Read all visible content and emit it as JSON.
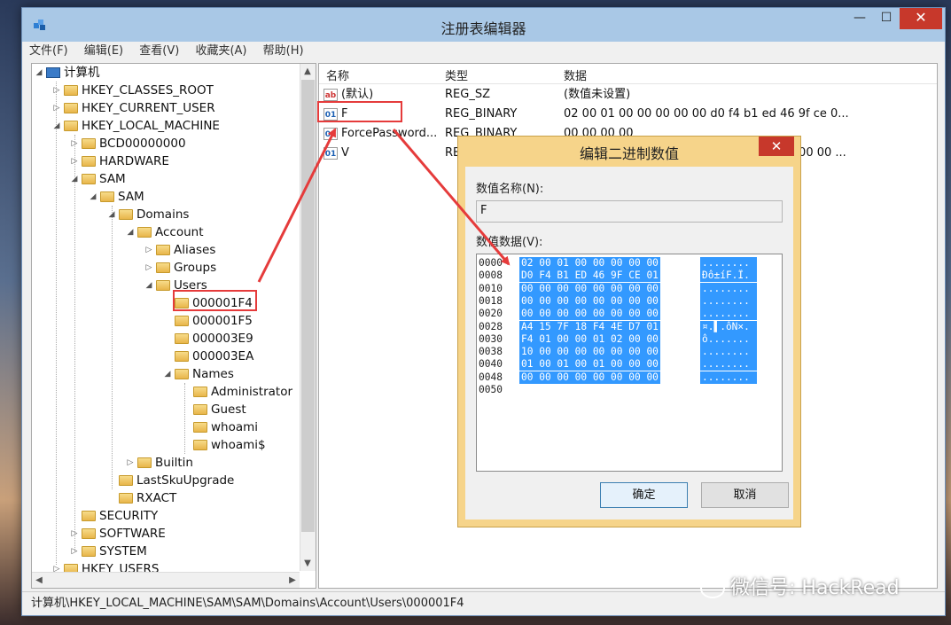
{
  "window": {
    "title": "注册表编辑器",
    "min_glyph": "—",
    "max_glyph": "☐",
    "close_glyph": "✕"
  },
  "menu": [
    "文件(F)",
    "编辑(E)",
    "查看(V)",
    "收藏夹(A)",
    "帮助(H)"
  ],
  "tree": {
    "root": "计算机",
    "hkcr": "HKEY_CLASSES_ROOT",
    "hkcu": "HKEY_CURRENT_USER",
    "hklm": "HKEY_LOCAL_MACHINE",
    "bcd": "BCD00000000",
    "hardware": "HARDWARE",
    "sam": "SAM",
    "sam2": "SAM",
    "domains": "Domains",
    "account": "Account",
    "aliases": "Aliases",
    "groups": "Groups",
    "users": "Users",
    "u1f4": "000001F4",
    "u1f5": "000001F5",
    "u3e9": "000003E9",
    "u3ea": "000003EA",
    "names": "Names",
    "administrator": "Administrator",
    "guest": "Guest",
    "whoami": "whoami",
    "whoamid": "whoami$",
    "builtin": "Builtin",
    "lastsku": "LastSkuUpgrade",
    "rxact": "RXACT",
    "security": "SECURITY",
    "software": "SOFTWARE",
    "system": "SYSTEM",
    "hku": "HKEY_USERS"
  },
  "list": {
    "headers": {
      "name": "名称",
      "type": "类型",
      "data": "数据"
    },
    "rows": [
      {
        "name": "(默认)",
        "type": "REG_SZ",
        "data": "(数值未设置)",
        "icon": "ab"
      },
      {
        "name": "F",
        "type": "REG_BINARY",
        "data": "02 00 01 00 00 00 00 00 d0 f4 b1 ed 46 9f ce 0...",
        "icon": "bin"
      },
      {
        "name": "ForcePassword...",
        "type": "REG_BINARY",
        "data": "00 00 00 00",
        "icon": "bin"
      },
      {
        "name": "V",
        "type": "REG_BINARY",
        "data": "00 00 00 00 f4 00 00 00 03 00 01 00 d4 00 00 ...",
        "icon": "bin"
      }
    ]
  },
  "statusbar": "计算机\\HKEY_LOCAL_MACHINE\\SAM\\SAM\\Domains\\Account\\Users\\000001F4",
  "dialog": {
    "title": "编辑二进制数值",
    "name_label": "数值名称(N):",
    "name_value": "F",
    "data_label": "数值数据(V):",
    "ok": "确定",
    "cancel": "取消",
    "hex_rows": [
      {
        "off": "0000",
        "bytes": "02 00 01 00 00 00 00 00",
        "ascii": "........"
      },
      {
        "off": "0008",
        "bytes": "D0 F4 B1 ED 46 9F CE 01",
        "ascii": "Ðô±íF.Î."
      },
      {
        "off": "0010",
        "bytes": "00 00 00 00 00 00 00 00",
        "ascii": "........"
      },
      {
        "off": "0018",
        "bytes": "00 00 00 00 00 00 00 00",
        "ascii": "........"
      },
      {
        "off": "0020",
        "bytes": "00 00 00 00 00 00 00 00",
        "ascii": "........"
      },
      {
        "off": "0028",
        "bytes": "A4 15 7F 18 F4 4E D7 01",
        "ascii": "¤.▌.ôN×."
      },
      {
        "off": "0030",
        "bytes": "F4 01 00 00 01 02 00 00",
        "ascii": "ô......."
      },
      {
        "off": "0038",
        "bytes": "10 00 00 00 00 00 00 00",
        "ascii": "........"
      },
      {
        "off": "0040",
        "bytes": "01 00 01 00 01 00 00 00",
        "ascii": "........"
      },
      {
        "off": "0048",
        "bytes": "00 00 00 00 00 00 00 00",
        "ascii": "........"
      },
      {
        "off": "0050",
        "bytes": "",
        "ascii": ""
      }
    ]
  },
  "watermark": "微信号: HackRead",
  "colors": {
    "annotation_red": "#e53b3b",
    "selection_blue": "#3399ff",
    "dialog_frame": "#f6d48a"
  }
}
